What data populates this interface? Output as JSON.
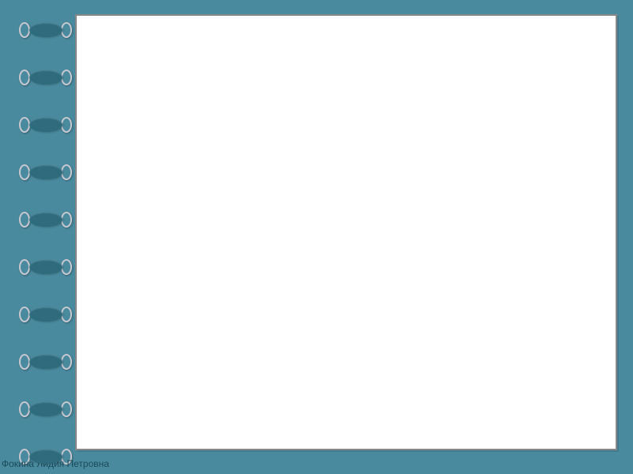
{
  "footer": {
    "author": "Фокина Лидия Петровна"
  },
  "bindings": {
    "count": 10
  }
}
